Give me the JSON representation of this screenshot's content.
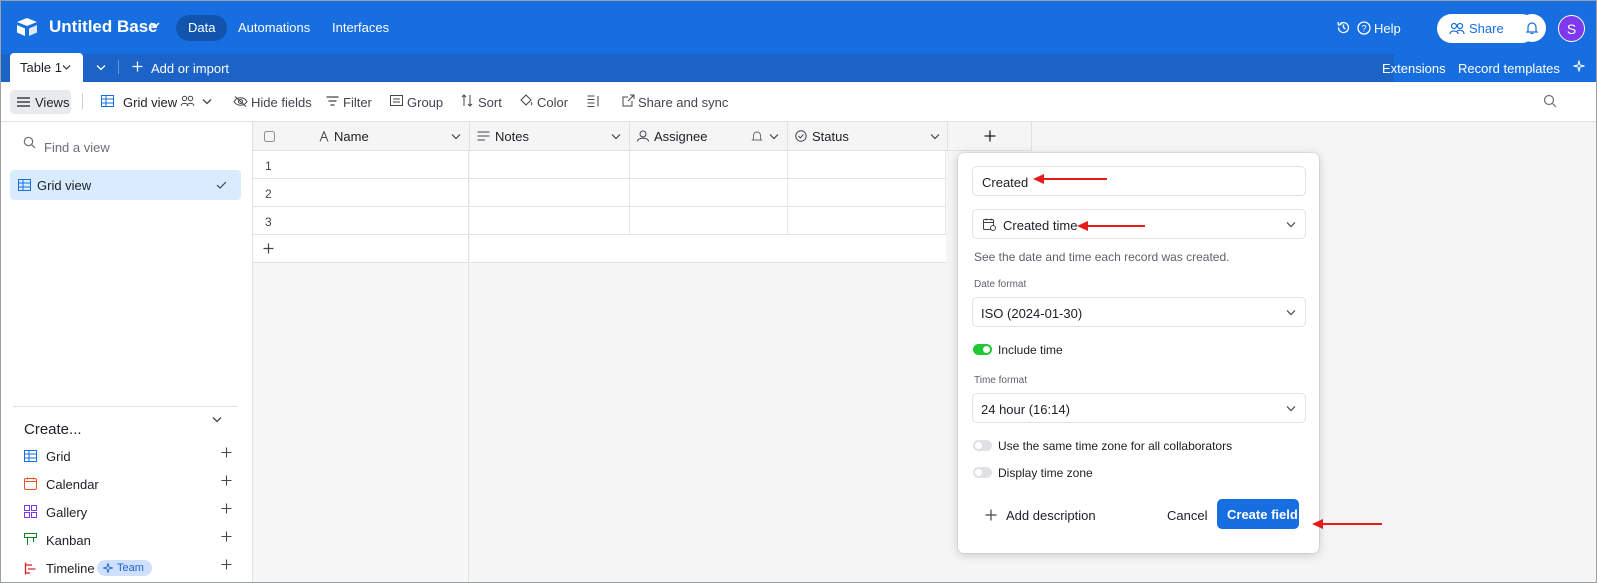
{
  "topbar": {
    "base_title": "Untitled Base",
    "nav": [
      "Data",
      "Automations",
      "Interfaces"
    ],
    "help": "Help",
    "share": "Share",
    "avatar_initial": "S"
  },
  "tabbar": {
    "active_table": "Table 1",
    "add_or_import": "Add or import",
    "extensions": "Extensions",
    "record_templates": "Record templates"
  },
  "viewbar": {
    "views": "Views",
    "grid_view": "Grid view",
    "hide_fields": "Hide fields",
    "filter": "Filter",
    "group": "Group",
    "sort": "Sort",
    "color": "Color",
    "share_and_sync": "Share and sync"
  },
  "sidebar": {
    "find_placeholder": "Find a view",
    "active_view": "Grid view",
    "create_title": "Create...",
    "create_items": [
      {
        "label": "Grid",
        "icon": "grid-icon",
        "color": "#166ee1"
      },
      {
        "label": "Calendar",
        "icon": "calendar-icon",
        "color": "#e8541c"
      },
      {
        "label": "Gallery",
        "icon": "gallery-icon",
        "color": "#7c39ed"
      },
      {
        "label": "Kanban",
        "icon": "kanban-icon",
        "color": "#0d7f1f"
      },
      {
        "label": "Timeline",
        "icon": "timeline-icon",
        "color": "#dc2626",
        "badge": "Team"
      }
    ]
  },
  "grid": {
    "columns": [
      "Name",
      "Notes",
      "Assignee",
      "Status"
    ],
    "rows": [
      "1",
      "2",
      "3"
    ]
  },
  "panel": {
    "field_name": "Created",
    "field_type": "Created time",
    "description": "See the date and time each record was created.",
    "date_format_label": "Date format",
    "date_format_value": "ISO (2024-01-30)",
    "include_time": "Include time",
    "time_format_label": "Time format",
    "time_format_value": "24 hour (16:14)",
    "same_timezone": "Use the same time zone for all collaborators",
    "display_timezone": "Display time zone",
    "add_description": "Add description",
    "cancel": "Cancel",
    "create_field": "Create field"
  },
  "colors": {
    "brand": "#166ee1",
    "toggle_on": "#20c933",
    "annotation_arrow": "#e31b1b"
  }
}
